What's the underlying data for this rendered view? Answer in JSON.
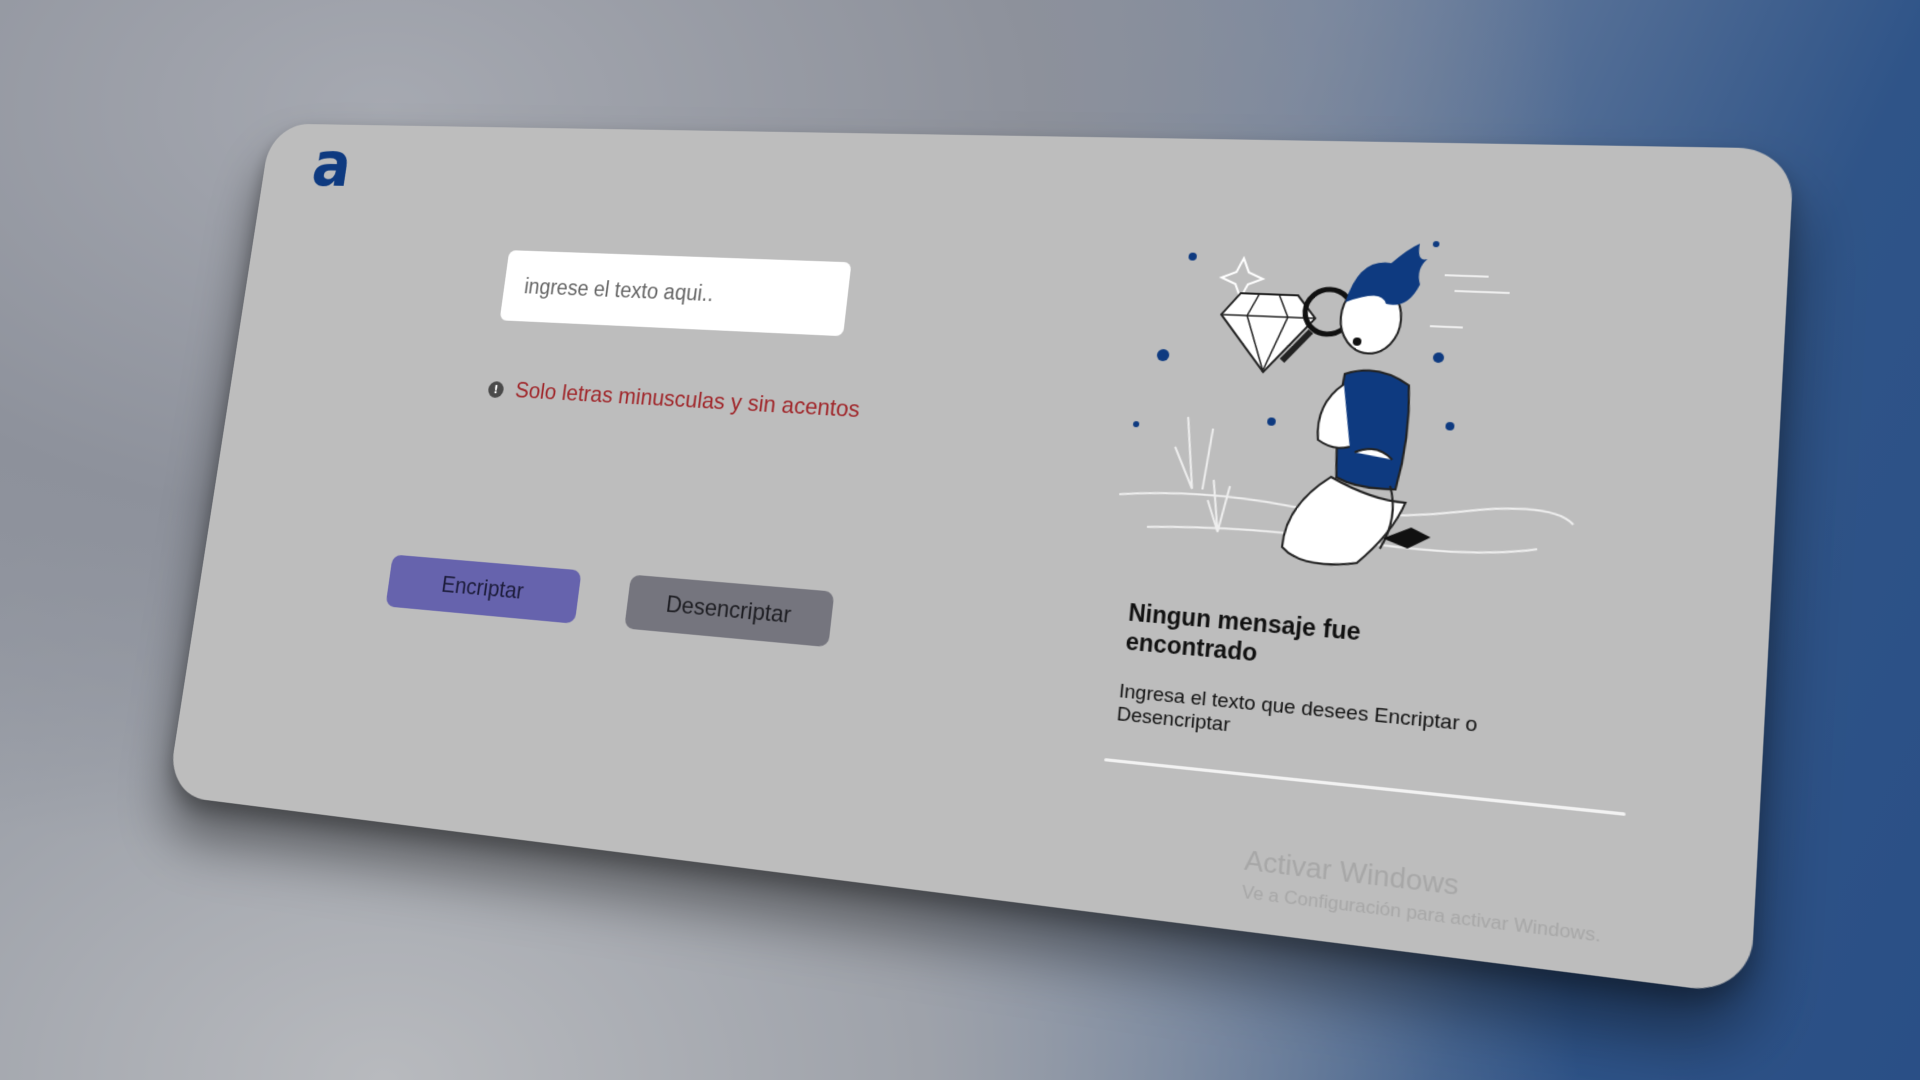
{
  "logo": {
    "glyph": "a",
    "color": "#0e3a80"
  },
  "input": {
    "placeholder": "ingrese el texto aqui.."
  },
  "warning": {
    "icon": "info-circle-icon",
    "text": "Solo letras minusculas y sin acentos",
    "color": "#a0262a"
  },
  "buttons": {
    "encrypt_label": "Encriptar",
    "decrypt_label": "Desencriptar",
    "encrypt_color": "#6663ad",
    "decrypt_color": "#75757e"
  },
  "output": {
    "illustration": "person-magnifying-glass-diamond-illustration",
    "title": "Ningun mensaje fue encontrado",
    "subtitle": "Ingresa el texto que desees Encriptar o Desencriptar"
  },
  "watermark": {
    "title": "Activar Windows",
    "subtitle": "Ve a Configuración para activar Windows."
  }
}
